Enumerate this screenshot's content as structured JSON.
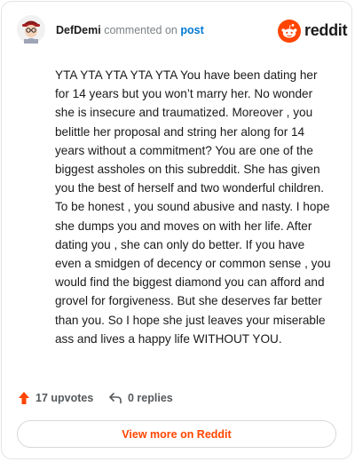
{
  "header": {
    "username": "DefDemi",
    "action_text": " commented on ",
    "post_link": "post",
    "brand_name": "reddit",
    "avatar_icon": "user-avatar-icon",
    "brand_icon": "reddit-snoo-icon"
  },
  "comment": {
    "body": "YTA YTA YTA YTA YTA You have been dating her for 14 years but you won’t marry her. No wonder she is insecure and traumatized. Moreover , you belittle her proposal and string her along for 14 years without a commitment? You are one of the biggest assholes on this subreddit. She has given you the best of herself and two wonderful children. To be honest , you sound abusive and nasty. I hope she dumps you and moves on with her life. After dating you , she can only do better. If you have even a smidgen of decency or common sense , you would find the biggest diamond you can afford and grovel for forgiveness. But she deserves far better than you. So I hope she just leaves your miserable ass and lives a happy life WITHOUT YOU."
  },
  "actions": {
    "upvotes_label": "17 upvotes",
    "replies_label": "0 replies",
    "upvote_icon": "upvote-arrow-icon",
    "reply_icon": "reply-arrow-icon"
  },
  "footer": {
    "view_more_label": "View more on Reddit"
  },
  "colors": {
    "brand": "#ff4500",
    "link": "#0079d3",
    "border": "#e2e4e6"
  }
}
